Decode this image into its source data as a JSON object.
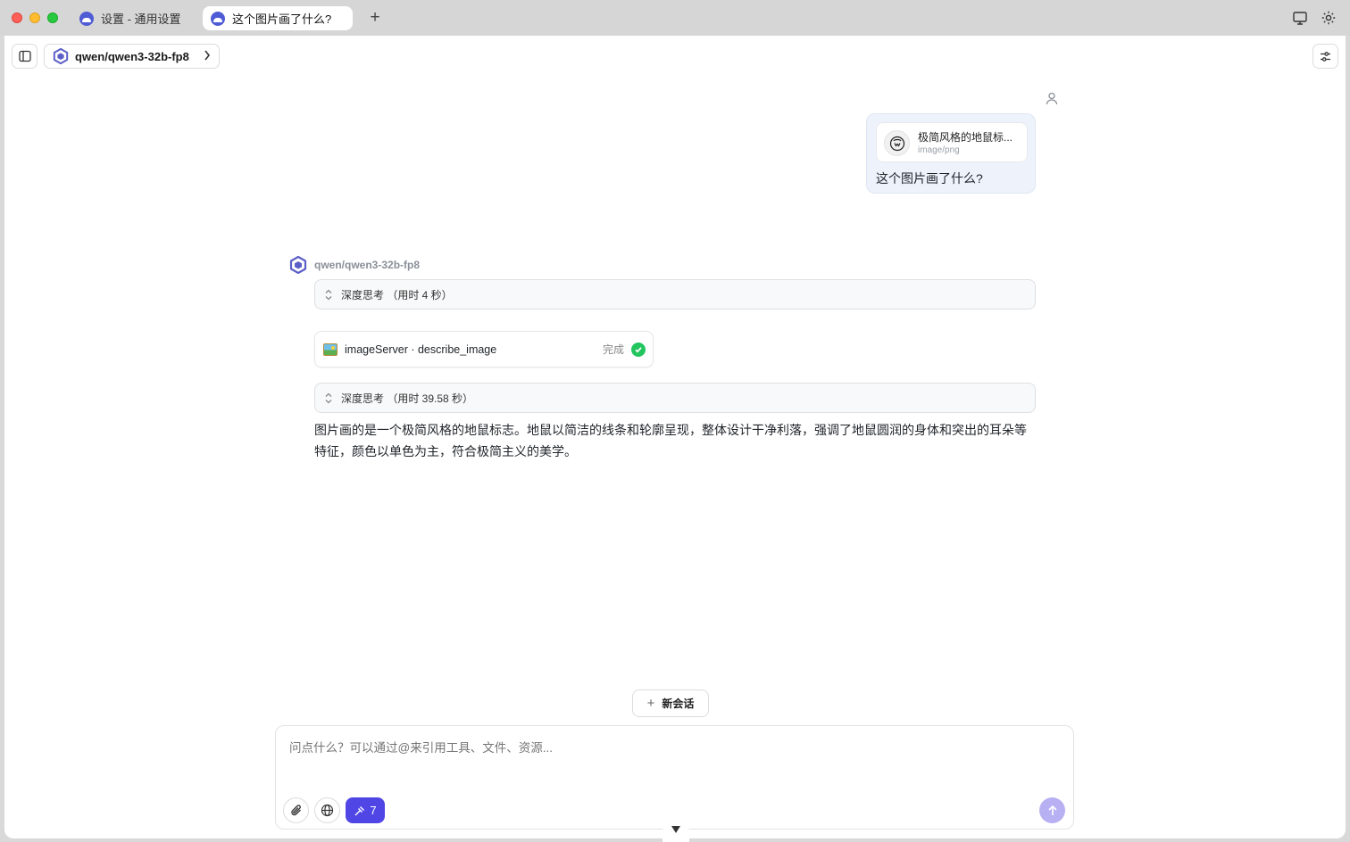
{
  "tabs": [
    {
      "label": "设置 - 通用设置",
      "active": false
    },
    {
      "label": "这个图片画了什么?",
      "active": true
    }
  ],
  "header": {
    "model_name": "qwen/qwen3-32b-fp8"
  },
  "user_message": {
    "attachment": {
      "name": "极简风格的地鼠标...",
      "type": "image/png"
    },
    "text": "这个图片画了什么?"
  },
  "assistant": {
    "model_name": "qwen/qwen3-32b-fp8",
    "thinking_1": "深度思考 （用时 4 秒）",
    "tool_call": {
      "name": "imageServer · describe_image",
      "status": "完成"
    },
    "thinking_2": "深度思考 （用时 39.58 秒）",
    "answer": "图片画的是一个极简风格的地鼠标志。地鼠以简洁的线条和轮廓呈现，整体设计干净利落，强调了地鼠圆润的身体和突出的耳朵等特征，颜色以单色为主，符合极简主义的美学。"
  },
  "new_chat_label": "新会话",
  "composer": {
    "placeholder": "问点什么？可以通过@来引用工具、文件、资源...",
    "tools_count": "7"
  },
  "colors": {
    "accent": "#5046e5",
    "send_disabled": "#b7b0f2",
    "success": "#22c55e"
  }
}
